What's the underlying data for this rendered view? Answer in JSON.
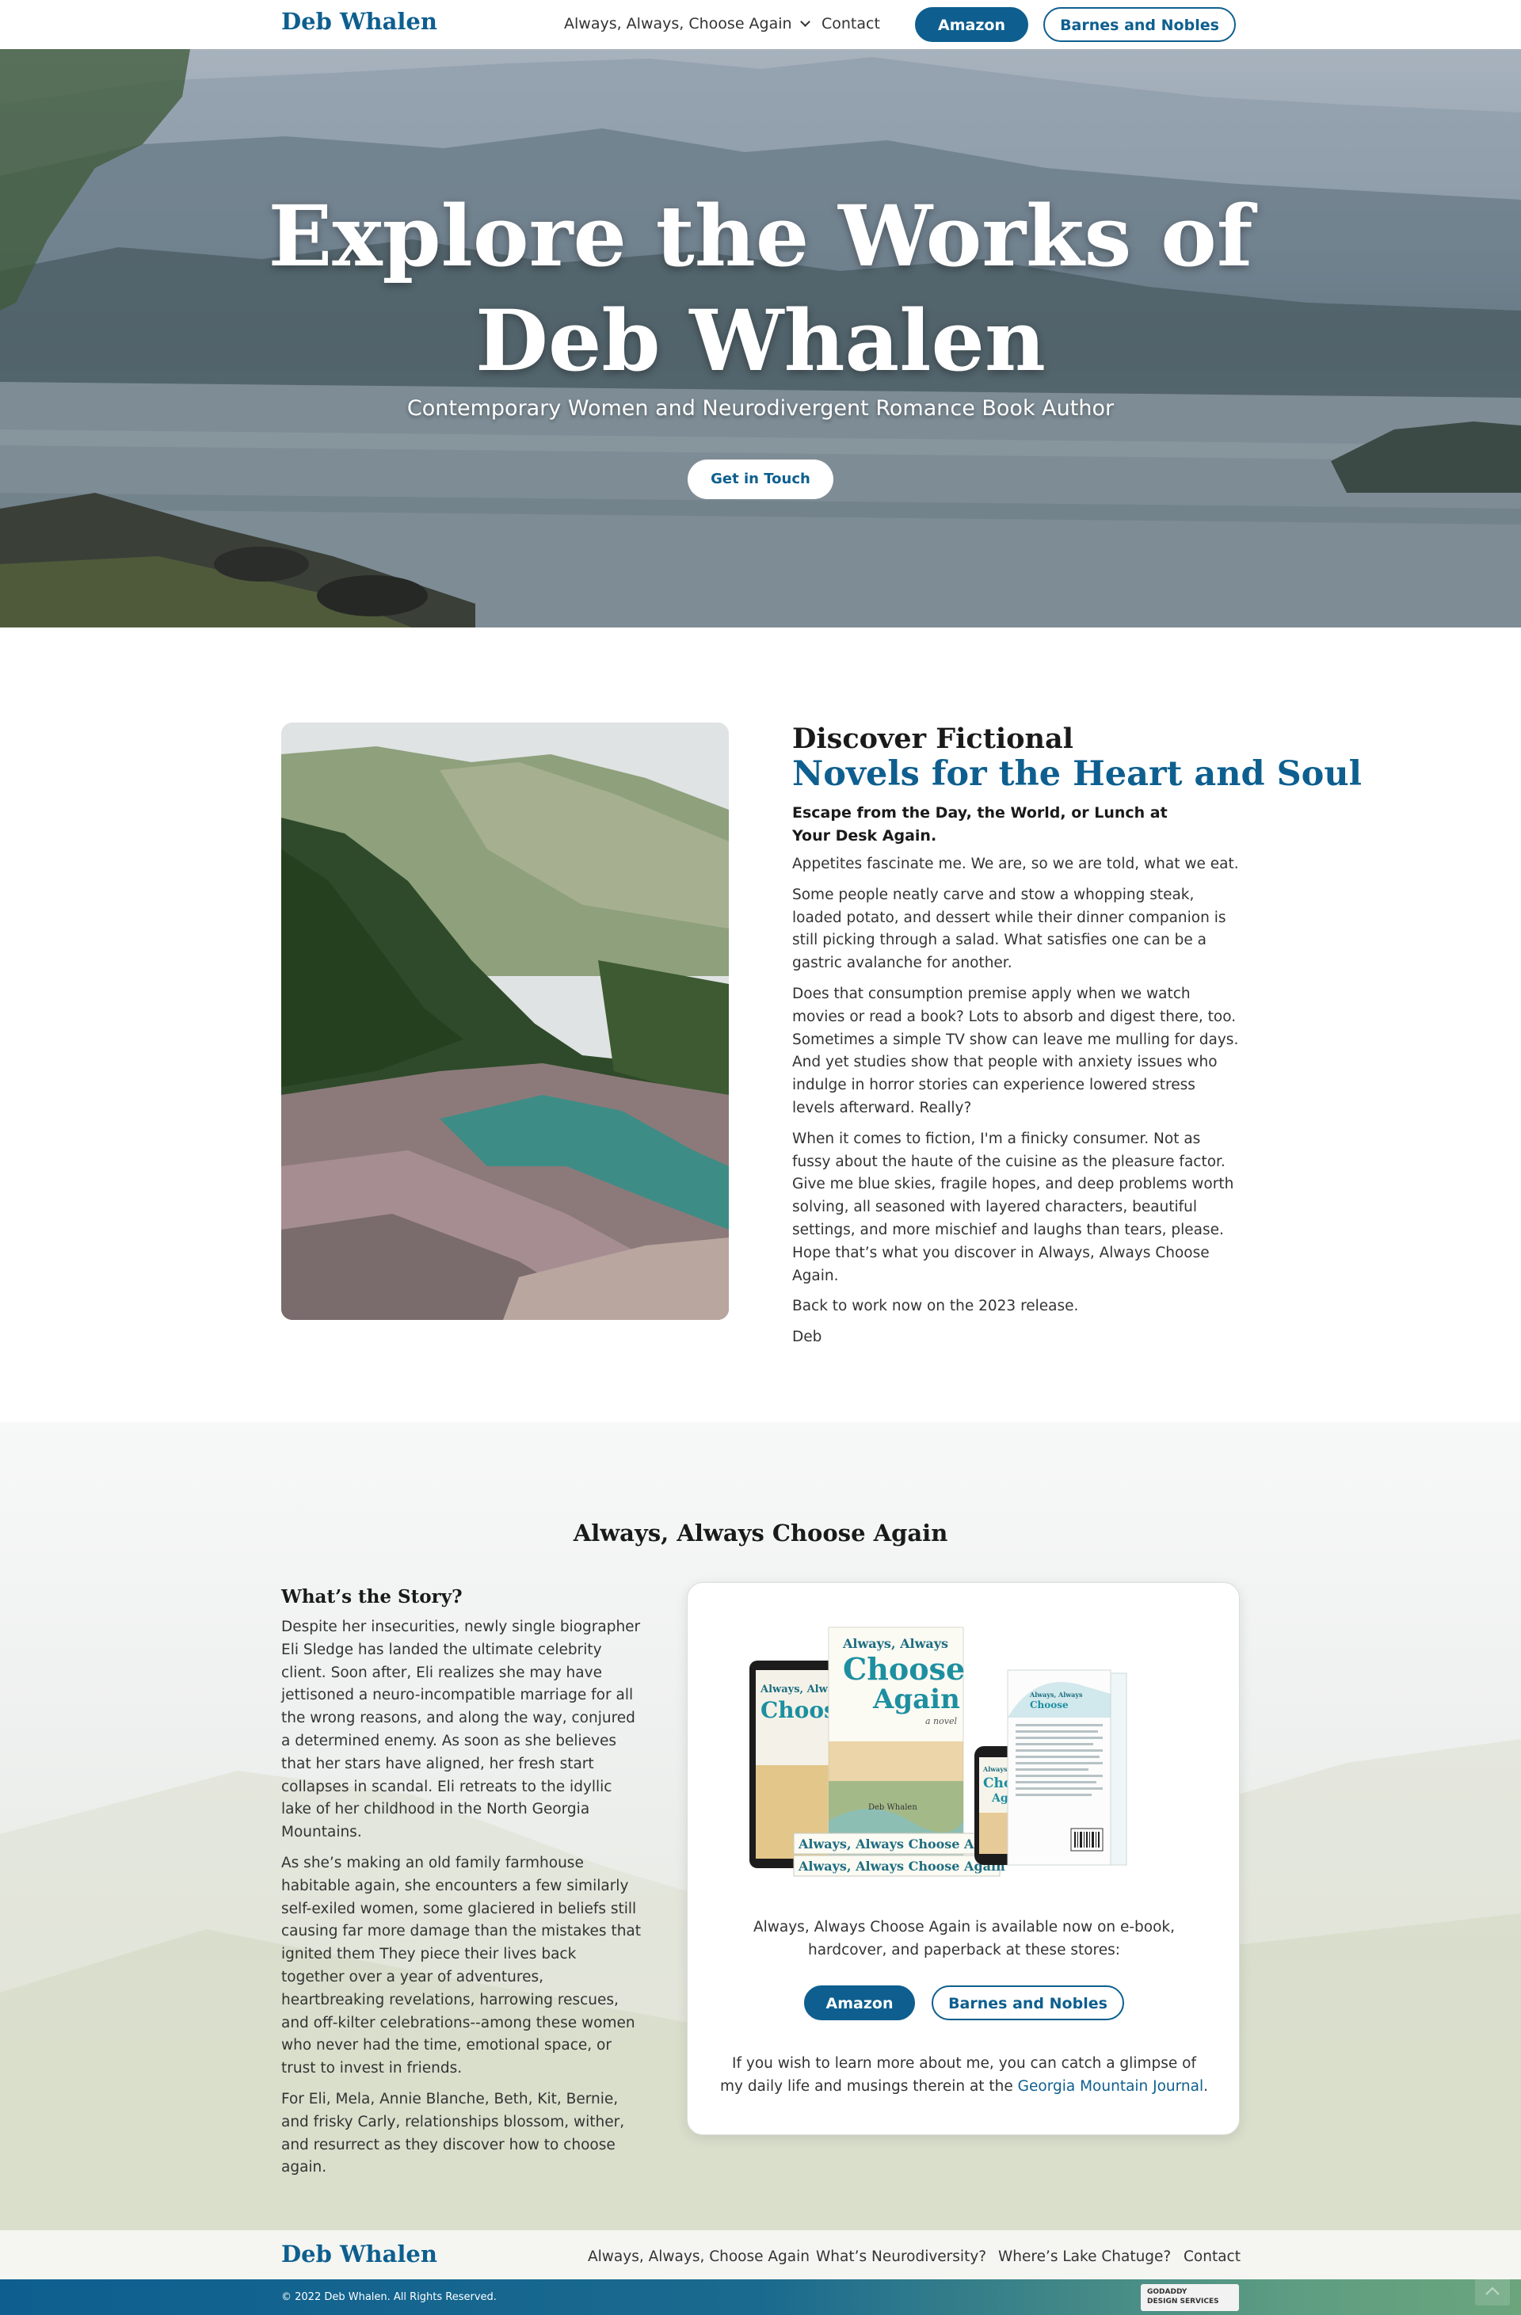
{
  "nav": {
    "brand": "Deb Whalen",
    "links": {
      "book": "Always, Always, Choose Again",
      "contact": "Contact"
    },
    "buttons": {
      "amazon": "Amazon",
      "barnes": "Barnes and Nobles"
    }
  },
  "hero": {
    "title_line1": "Explore the Works of",
    "title_line2": "Deb Whalen",
    "subtitle": "Contemporary Women and Neurodivergent Romance Book Author",
    "cta": "Get in Touch"
  },
  "discover": {
    "heading1": "Discover Fictional",
    "heading2": "Novels for the Heart and Soul",
    "lead": "Escape from the Day, the World, or Lunch at Your Desk Again.",
    "paragraphs": [
      "Appetites fascinate me. We are, so we are told, what we eat.",
      "Some people neatly carve and stow a whopping steak, loaded potato, and dessert while their dinner companion is still picking through a salad. What satisfies one can be a gastric avalanche for another.",
      "Does that consumption premise apply when we watch movies or read a book? Lots to absorb and digest there, too. Sometimes a simple TV show can leave me mulling for days. And yet studies show that people with anxiety issues who indulge in horror stories can experience lowered stress levels afterward. Really?",
      "When it comes to fiction, I'm a finicky consumer. Not as fussy about the haute of the cuisine as the pleasure factor. Give me blue skies, fragile hopes, and deep problems worth solving, all seasoned with layered characters, beautiful settings, and more mischief and laughs than tears, please. Hope that’s what you discover in Always, Always Choose Again.",
      "Back to work now on the 2023 release.",
      "Deb"
    ]
  },
  "book": {
    "title": "Always, Always Choose Again",
    "story_heading": "What’s the Story?",
    "story": [
      "Despite her insecurities, newly single biographer Eli Sledge has landed the ultimate celebrity client. Soon after, Eli realizes she may have jettisoned a neuro-incompatible marriage for all the wrong reasons, and along the way, conjured a determined enemy. As soon as she believes that her stars have aligned, her fresh start collapses in scandal. Eli retreats to the idyllic lake of her childhood in the North Georgia Mountains.",
      "As she’s making an old family farmhouse habitable again, she encounters a few similarly self-exiled women, some glaciered in beliefs still causing far more damage than the mistakes that ignited them They piece their lives back together over a year of adventures, heartbreaking revelations, harrowing rescues, and off-kilter celebrations--among these women who never had the time, emotional space, or trust to invest in friends.",
      "For Eli, Mela, Annie Blanche, Beth, Kit, Bernie, and frisky Carly, relationships blossom, wither, and resurrect as they discover how to choose again."
    ],
    "cover": {
      "title_a": "Always, Always",
      "title_b": "Choose",
      "title_c": "Again",
      "tag": "a novel",
      "author": "Deb Whalen",
      "spine": "Always, Always Choose Again"
    },
    "availability": "Always, Always Choose Again is available now on e-book, hardcover, and paperback at these stores:",
    "buttons": {
      "amazon": "Amazon",
      "barnes": "Barnes and Nobles"
    },
    "more_prefix": "If you wish to learn more about me, you can catch a glimpse of my daily life and musings therein at the ",
    "more_link": "Georgia Mountain Journal",
    "more_suffix": "."
  },
  "footer": {
    "brand": "Deb Whalen",
    "links": [
      "Always, Always, Choose Again",
      "What’s Neurodiversity?",
      "Where’s Lake Chatuge?",
      "Contact"
    ],
    "copyright": "© 2022 Deb Whalen. All Rights Reserved.",
    "badge_line1": "GODADDY",
    "badge_line2": "DESIGN SERVICES"
  },
  "colors": {
    "brand": "#0e5f8f",
    "text": "#333333",
    "heading": "#1a1a1a"
  }
}
